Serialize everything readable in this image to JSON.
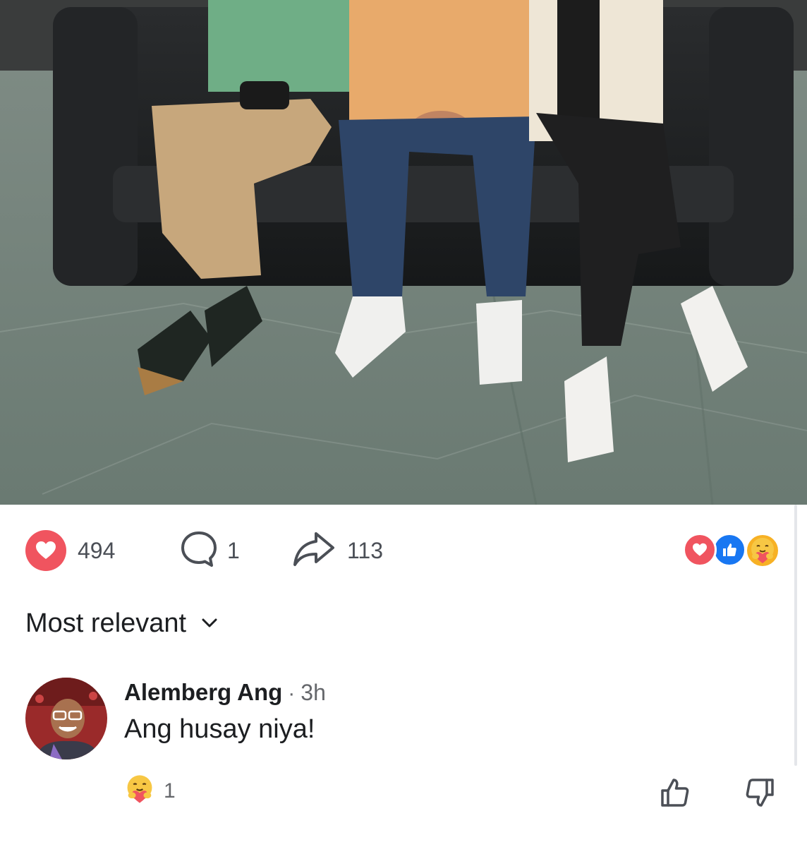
{
  "post": {
    "photo_alt": "Three people seated on a black leather sofa on a marble floor"
  },
  "actions": {
    "reactions_count": "494",
    "comments_count": "1",
    "shares_count": "113"
  },
  "reaction_summary": {
    "icons": [
      "love-reaction-icon",
      "like-reaction-icon",
      "care-reaction-icon"
    ]
  },
  "sort": {
    "label": "Most relevant"
  },
  "comment": {
    "author": "Alemberg Ang",
    "separator": "·",
    "time": "3h",
    "text": "Ang husay niya!",
    "reaction_count": "1"
  },
  "colors": {
    "love": "#f0545f",
    "like": "#1877f2",
    "care": "#f7b125",
    "secondary_text": "#65676b"
  }
}
